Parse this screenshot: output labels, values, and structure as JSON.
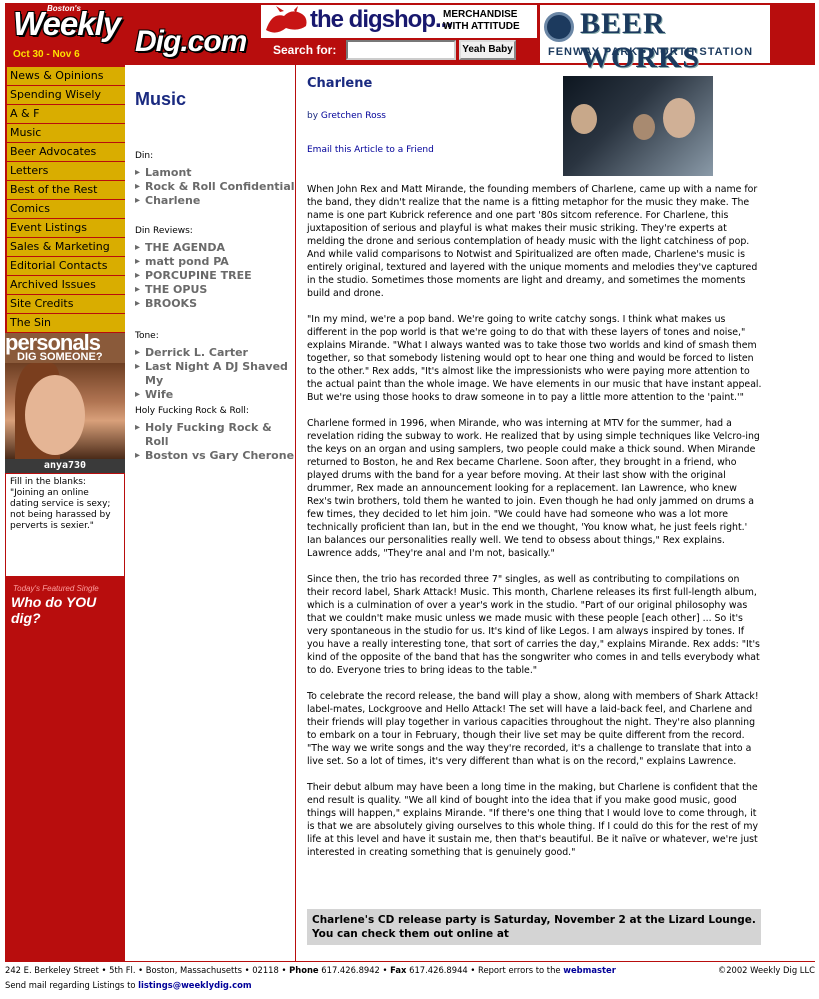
{
  "header": {
    "logo_top": "Boston's",
    "logo_weekly": "Weekly",
    "logo_dig": "Dig.com",
    "dates": "Oct 30 - Nov 6",
    "digshop_name": "the digshop...",
    "digshop_tag1": "MERCHANDISE",
    "digshop_tag2": "WITH ATTITUDE",
    "search_label": "Search for:",
    "search_value": "",
    "search_button": "Yeah Baby",
    "beerworks_name": "BEER WORKS",
    "beerworks_loc": "FENWAY PARK • NORTH STATION",
    "colors": {
      "brand_red": "#b80d0d",
      "nav_gold": "#d9ad00",
      "title_blue": "#1a2a80"
    }
  },
  "nav": [
    "News & Opinions",
    "Spending Wisely",
    "A & F",
    "Music",
    "Beer Advocates",
    "Letters",
    "Best of the Rest",
    "Comics",
    "Event Listings",
    "Sales & Marketing",
    "Editorial Contacts",
    "Archived Issues",
    "Site Credits",
    "The Sin"
  ],
  "personals": {
    "title": "personals",
    "subtitle": "DIG SOMEONE?",
    "name": "anya730",
    "fill_label": "Fill in the blanks:",
    "fill_1": "\"Joining an online",
    "fill_2": "dating service is sexy;",
    "fill_3": "not being harassed by",
    "fill_4": "perverts is sexier.\"",
    "featured_label": "Today's Featured Single",
    "featured_cta": "Who do YOU dig?"
  },
  "middle": {
    "section_title": "Music",
    "groups": [
      {
        "label": "Din:",
        "items": [
          "Lamont",
          "Rock & Roll Confidential",
          "Charlene"
        ]
      },
      {
        "label": "Din Reviews:",
        "items": [
          "THE AGENDA",
          "matt pond PA",
          "PORCUPINE TREE",
          "THE OPUS",
          "BROOKS"
        ]
      },
      {
        "label": "Tone:",
        "items": [
          "Derrick L. Carter",
          "Last Night A DJ Shaved My",
          "Wife"
        ]
      },
      {
        "label": "Holy Fucking Rock & Roll:",
        "items": [
          "Holy Fucking Rock & Roll",
          "Boston vs Gary Cherone"
        ]
      }
    ]
  },
  "article": {
    "title": "Charlene",
    "by": "by",
    "author": "Gretchen Ross",
    "email_link": "Email this Article to a Friend",
    "paragraphs": [
      "When John Rex and Matt Mirande, the founding members of Charlene, came up with a name for the band, they didn't realize that the name is a fitting metaphor for the music they make. The name is one part Kubrick reference and one part '80s sitcom reference. For Charlene, this juxtaposition of serious and playful is what makes their music striking. They're experts at melding the drone and serious contemplation of heady music with the light catchiness of pop. And while valid comparisons to Notwist and Spiritualized are often made, Charlene's music is entirely original, textured and layered with the unique moments and melodies they've captured in the studio. Sometimes those moments are light and dreamy, and sometimes the moments build and drone.",
      "\"In my mind, we're a pop band. We're going to write catchy songs. I think what makes us different in the pop world is that we're going to do that with these layers of tones and noise,\" explains Mirande. \"What I always wanted was to take those two worlds and kind of smash them together, so that somebody listening would opt to hear one thing and would be forced to listen to the other.\" Rex adds, \"It's almost like the impressionists who were paying more attention to the actual paint than the whole image. We have elements in our music that have instant appeal. But we're using those hooks to draw someone in to pay a little more attention to the 'paint.'\"",
      "Charlene formed in 1996, when Mirande, who was interning at MTV for the summer, had a revelation riding the subway to work. He realized that by using simple techniques like Velcro-ing the keys on an organ and using samplers, two people could make a thick sound. When Mirande returned to Boston, he and Rex became Charlene. Soon after, they brought in a friend, who played drums with the band for a year before moving. At their last show with the original drummer, Rex made an announcement looking for a replacement. Ian Lawrence, who knew Rex's twin brothers, told them he wanted to join. Even though he had only jammed on drums a few times, they decided to let him join. \"We could have had someone who was a lot more technically proficient than Ian, but in the end we thought, 'You know what, he just feels right.' Ian balances our personalities really well. We tend to obsess about things,\" Rex explains. Lawrence adds, \"They're anal and I'm not, basically.\"",
      "Since then, the trio has recorded three 7\" singles, as well as contributing to compilations on their record label, Shark Attack! Music. This month, Charlene releases its first full-length album, which is a culmination of over a year's work in the studio. \"Part of our original philosophy was that we couldn't make music unless we made music with these people [each other] ... So it's very spontaneous in the studio for us. It's kind of like Legos. I am always inspired by tones. If you have a really interesting tone, that sort of carries the day,\" explains Mirande. Rex adds: \"It's kind of the opposite of the band that has the songwriter who comes in and tells everybody what to do. Everyone tries to bring ideas to the table.\"",
      "To celebrate the record release, the band will play a show, along with members of Shark Attack! label-mates, Lockgroove and Hello Attack! The set will have a laid-back feel, and Charlene and their friends will play together in various capacities throughout the night. They're also planning to embark on a tour in February, though their live set may be quite different from the record. \"The way we write songs and the way they're recorded, it's a challenge to translate that into a live set. So a lot of times, it's very different than what is on the record,\" explains Lawrence.",
      "Their debut album may have been a long time in the making, but Charlene is confident that the end result is quality. \"We all kind of bought into the idea that if you make good music, good things will happen,\" explains Mirande. \"If there's one thing that I would love to come through, it is that we are absolutely giving ourselves to this whole thing. If I could do this for the rest of my life at this level and have it sustain me, then that's beautiful. Be it naïve or whatever, we're just interested in creating something that is genuinely good.\""
    ],
    "callout": "Charlene's CD release party is Saturday, November 2 at the Lizard Lounge. You can check them out online at"
  },
  "footer": {
    "address": "242 E. Berkeley Street • 5th Fl. • Boston, Massachusetts • 02118 •",
    "phone_label": "Phone",
    "phone": "617.426.8942 •",
    "fax_label": "Fax",
    "fax": "617.426.8944 • Report errors to the",
    "webmaster": "webmaster",
    "listings_text": "Send mail regarding Listings to",
    "listings_email": "listings@weeklydig.com",
    "copyright": "©2002 Weekly Dig LLC"
  }
}
